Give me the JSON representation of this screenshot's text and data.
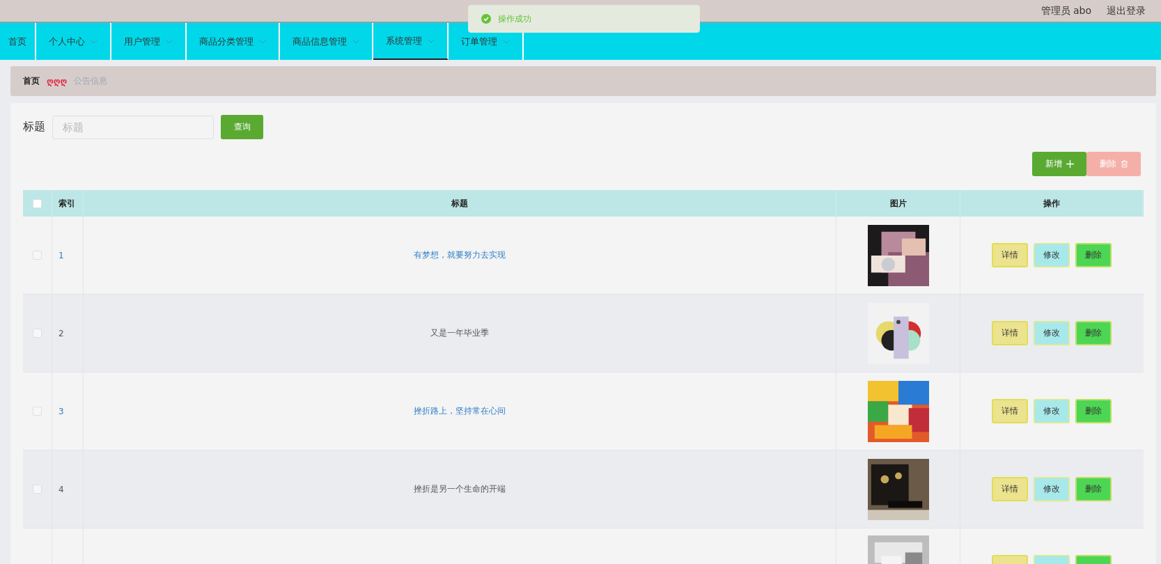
{
  "header": {
    "user": "管理员 abo",
    "logout": "退出登录"
  },
  "toast": {
    "message": "操作成功"
  },
  "nav": [
    {
      "label": "首页",
      "dropdown": false,
      "selected": false
    },
    {
      "label": "个人中心",
      "dropdown": true,
      "selected": false
    },
    {
      "label": "用户管理",
      "dropdown": true,
      "selected": false
    },
    {
      "label": "商品分类管理",
      "dropdown": true,
      "selected": false
    },
    {
      "label": "商品信息管理",
      "dropdown": true,
      "selected": false
    },
    {
      "label": "系统管理",
      "dropdown": true,
      "selected": true
    },
    {
      "label": "订单管理",
      "dropdown": true,
      "selected": false
    }
  ],
  "breadcrumb": {
    "home": "首页",
    "separator": "ღღღ",
    "current": "公告信息"
  },
  "search": {
    "label": "标题",
    "placeholder": "标题",
    "button": "查询"
  },
  "actions": {
    "add": "新增",
    "delete": "删除",
    "delete_disabled": true
  },
  "table": {
    "select_all": false,
    "columns": [
      "索引",
      "标题",
      "图片",
      "操作"
    ],
    "rows": [
      {
        "kind": "full",
        "checked": false,
        "index": "1",
        "title": "有梦想，就要努力去实现",
        "link": true,
        "picture": {
          "kind": "picture"
        },
        "buttons": [
          "详情",
          "修改",
          "删除"
        ]
      },
      {
        "kind": "full",
        "checked": false,
        "index": "2",
        "title": "又是一年毕业季",
        "link": false,
        "picture": {
          "kind": "picture"
        },
        "buttons": [
          "详情",
          "修改",
          "删除"
        ]
      },
      {
        "kind": "full",
        "checked": false,
        "index": "3",
        "title": "挫折路上，坚持常在心间",
        "link": true,
        "picture": {
          "kind": "picture"
        },
        "buttons": [
          "详情",
          "修改",
          "删除"
        ]
      },
      {
        "kind": "full",
        "checked": false,
        "index": "4",
        "title": "挫折是另一个生命的开端",
        "link": false,
        "picture": {
          "kind": "picture"
        },
        "buttons": [
          "详情",
          "修改",
          "删除"
        ]
      },
      {
        "kind": "cut",
        "picture": {
          "kind": "picture"
        }
      }
    ]
  }
}
